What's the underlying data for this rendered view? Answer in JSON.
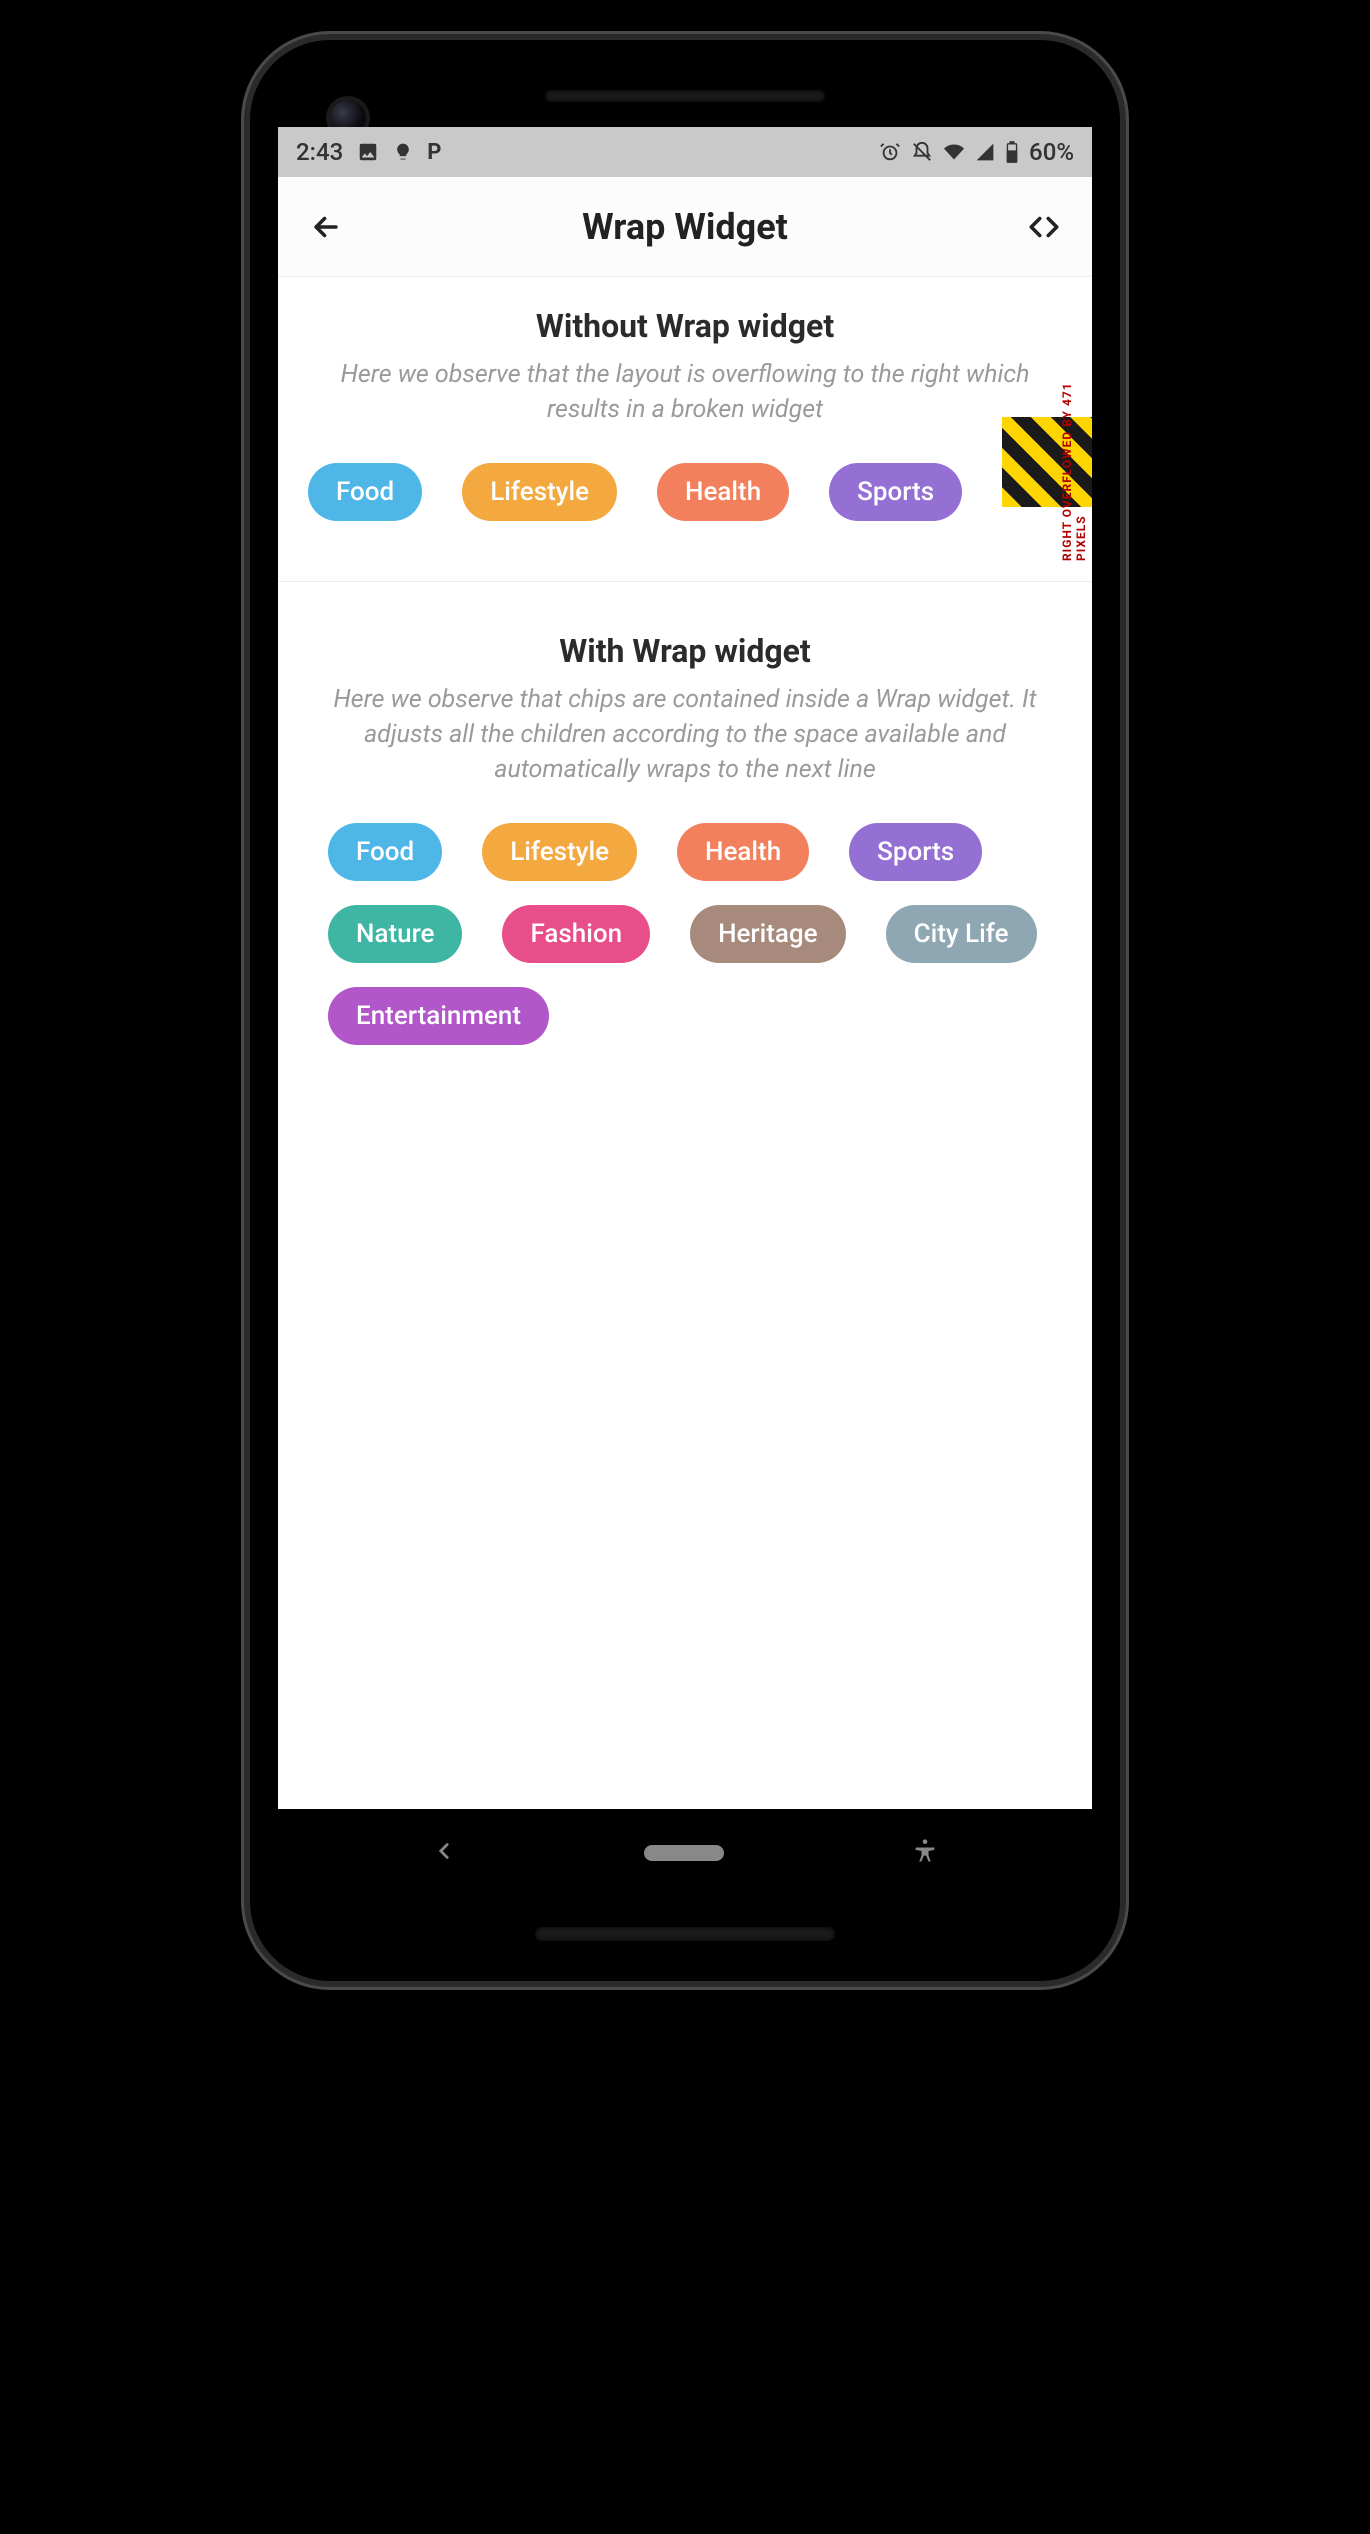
{
  "status": {
    "time": "2:43",
    "battery": "60%"
  },
  "appbar": {
    "title": "Wrap Widget"
  },
  "sections": {
    "without": {
      "title": "Without Wrap widget",
      "desc": "Here we observe that the layout is overflowing to the right which results in a broken widget",
      "chips": [
        {
          "label": "Food",
          "color": "#4fb6e8"
        },
        {
          "label": "Lifestyle",
          "color": "#f3a93f"
        },
        {
          "label": "Health",
          "color": "#f2805d"
        },
        {
          "label": "Sports",
          "color": "#9470d4"
        }
      ]
    },
    "with": {
      "title": "With Wrap widget",
      "desc": "Here we observe that chips are contained inside a Wrap widget. It adjusts all the children according to the space available and automatically wraps to the next line",
      "chips": [
        {
          "label": "Food",
          "color": "#4fb6e8"
        },
        {
          "label": "Lifestyle",
          "color": "#f3a93f"
        },
        {
          "label": "Health",
          "color": "#f2805d"
        },
        {
          "label": "Sports",
          "color": "#9470d4"
        },
        {
          "label": "Nature",
          "color": "#3fb6a3"
        },
        {
          "label": "Fashion",
          "color": "#e84e8a"
        },
        {
          "label": "Heritage",
          "color": "#a78a7c"
        },
        {
          "label": "City Life",
          "color": "#8fa6b3"
        },
        {
          "label": "Entertainment",
          "color": "#b257c9"
        }
      ]
    }
  },
  "overflow": {
    "text": "RIGHT OVERFLOWED BY 471 PIXELS"
  }
}
